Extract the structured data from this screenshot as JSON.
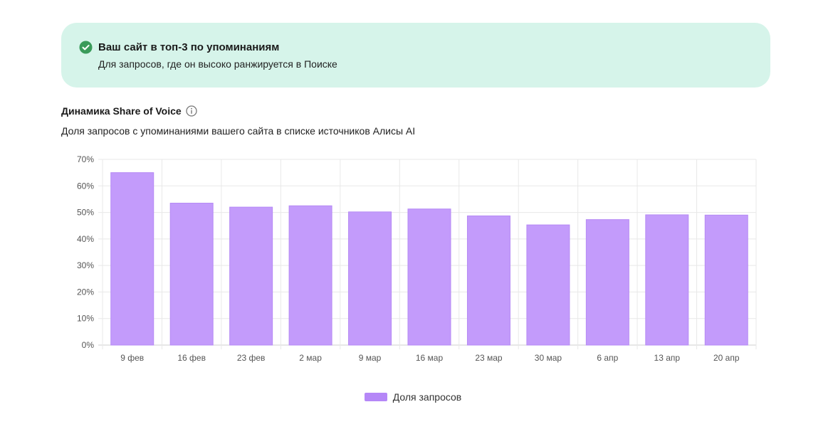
{
  "banner": {
    "title": "Ваш сайт в топ-3 по упоминаниям",
    "subtitle": "Для запросов, где он высоко ранжируется в Поиске",
    "icon": "check-circle-icon",
    "icon_color": "#3a9b5a",
    "background": "#d6f4ea"
  },
  "section": {
    "title": "Динамика Share of Voice",
    "subtitle": "Доля запросов с упоминаниями вашего сайта в списке источников Алисы AI",
    "info_icon": "info-icon"
  },
  "chart_data": {
    "type": "bar",
    "categories": [
      "9 фев",
      "16 фев",
      "23 фев",
      "2 мар",
      "9 мар",
      "16 мар",
      "23 мар",
      "30 мар",
      "6 апр",
      "13 апр",
      "20 апр"
    ],
    "series": [
      {
        "name": "Доля запросов",
        "values": [
          65,
          53.5,
          52,
          52.5,
          50.2,
          51.3,
          48.7,
          45.3,
          47.3,
          49.1,
          49
        ]
      }
    ],
    "ylim": [
      0,
      70
    ],
    "yticks": [
      0,
      10,
      20,
      30,
      40,
      50,
      60,
      70
    ],
    "ytick_labels": [
      "0%",
      "10%",
      "20%",
      "30%",
      "40%",
      "50%",
      "60%",
      "70%"
    ],
    "grid": true,
    "legend_position": "bottom-center",
    "bar_color": "#c39bfb",
    "bar_border_color": "#b68af5"
  },
  "legend": {
    "label": "Доля запросов"
  }
}
